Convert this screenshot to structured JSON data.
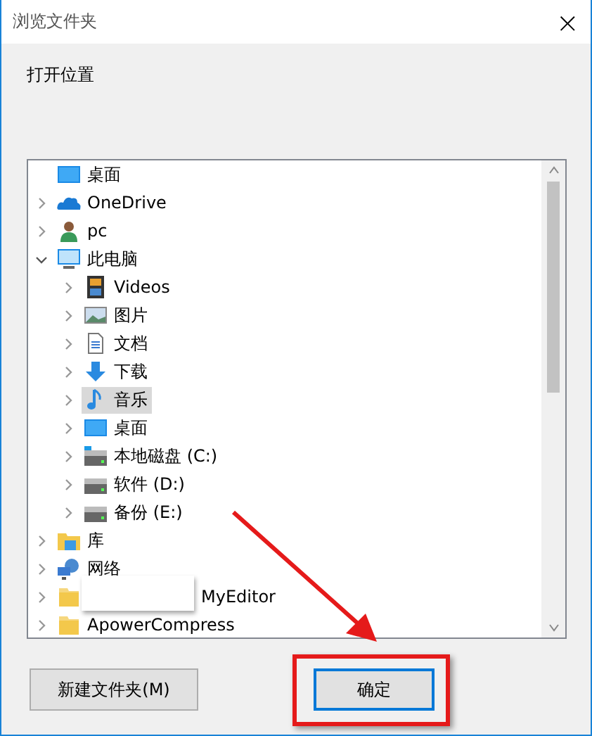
{
  "window": {
    "title": "浏览文件夹",
    "close": "×"
  },
  "prompt": "打开位置",
  "tree": [
    {
      "label": "桌面",
      "kind": "desktop",
      "selected": false
    },
    {
      "label": "OneDrive",
      "kind": "cloud",
      "expanded": false,
      "selected": false
    },
    {
      "label": "pc",
      "kind": "user",
      "expanded": false,
      "selected": false
    },
    {
      "label": "此电脑",
      "kind": "computer",
      "expanded": true,
      "selected": false,
      "children": [
        {
          "label": "Videos",
          "kind": "videos",
          "expanded": false,
          "selected": false
        },
        {
          "label": "图片",
          "kind": "pictures",
          "expanded": false,
          "selected": false
        },
        {
          "label": "文档",
          "kind": "documents",
          "expanded": false,
          "selected": false
        },
        {
          "label": "下载",
          "kind": "downloads",
          "expanded": false,
          "selected": false
        },
        {
          "label": "音乐",
          "kind": "music",
          "expanded": false,
          "selected": true
        },
        {
          "label": "桌面",
          "kind": "desktop",
          "expanded": false,
          "selected": false
        },
        {
          "label": "本地磁盘 (C:)",
          "kind": "system-drive",
          "expanded": false,
          "selected": false
        },
        {
          "label": "软件 (D:)",
          "kind": "drive",
          "expanded": false,
          "selected": false
        },
        {
          "label": "备份 (E:)",
          "kind": "drive",
          "expanded": false,
          "selected": false
        }
      ]
    },
    {
      "label": "库",
      "kind": "library",
      "expanded": false,
      "selected": false
    },
    {
      "label": "网络",
      "kind": "network",
      "expanded": false,
      "selected": false
    },
    {
      "label": "MyEditor",
      "kind": "folder",
      "expanded": false,
      "selected": false,
      "redacted": true
    },
    {
      "label": "ApowerCompress",
      "kind": "folder",
      "expanded": false,
      "selected": false
    }
  ],
  "buttons": [
    {
      "label": "新建文件夹(M)",
      "default": false,
      "highlighted": false
    },
    {
      "label": "确定",
      "default": true,
      "highlighted": true
    }
  ]
}
